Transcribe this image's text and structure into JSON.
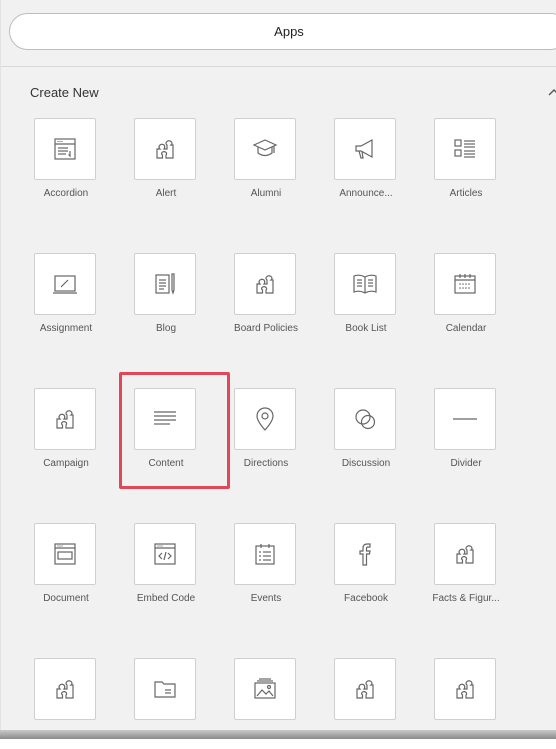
{
  "apps_button": {
    "label": "Apps"
  },
  "section": {
    "title": "Create New"
  },
  "tiles": [
    {
      "label": "Accordion"
    },
    {
      "label": "Alert"
    },
    {
      "label": "Alumni"
    },
    {
      "label": "Announce..."
    },
    {
      "label": "Articles"
    },
    {
      "label": "Assignment"
    },
    {
      "label": "Blog"
    },
    {
      "label": "Board Policies"
    },
    {
      "label": "Book List"
    },
    {
      "label": "Calendar"
    },
    {
      "label": "Campaign"
    },
    {
      "label": "Content"
    },
    {
      "label": "Directions"
    },
    {
      "label": "Discussion"
    },
    {
      "label": "Divider"
    },
    {
      "label": "Document"
    },
    {
      "label": "Embed Code"
    },
    {
      "label": "Events"
    },
    {
      "label": "Facebook"
    },
    {
      "label": "Facts & Figur..."
    },
    {
      "label": ""
    },
    {
      "label": ""
    },
    {
      "label": ""
    },
    {
      "label": ""
    },
    {
      "label": ""
    }
  ],
  "highlight": {
    "tile": "Content",
    "color": "#e0485a"
  }
}
